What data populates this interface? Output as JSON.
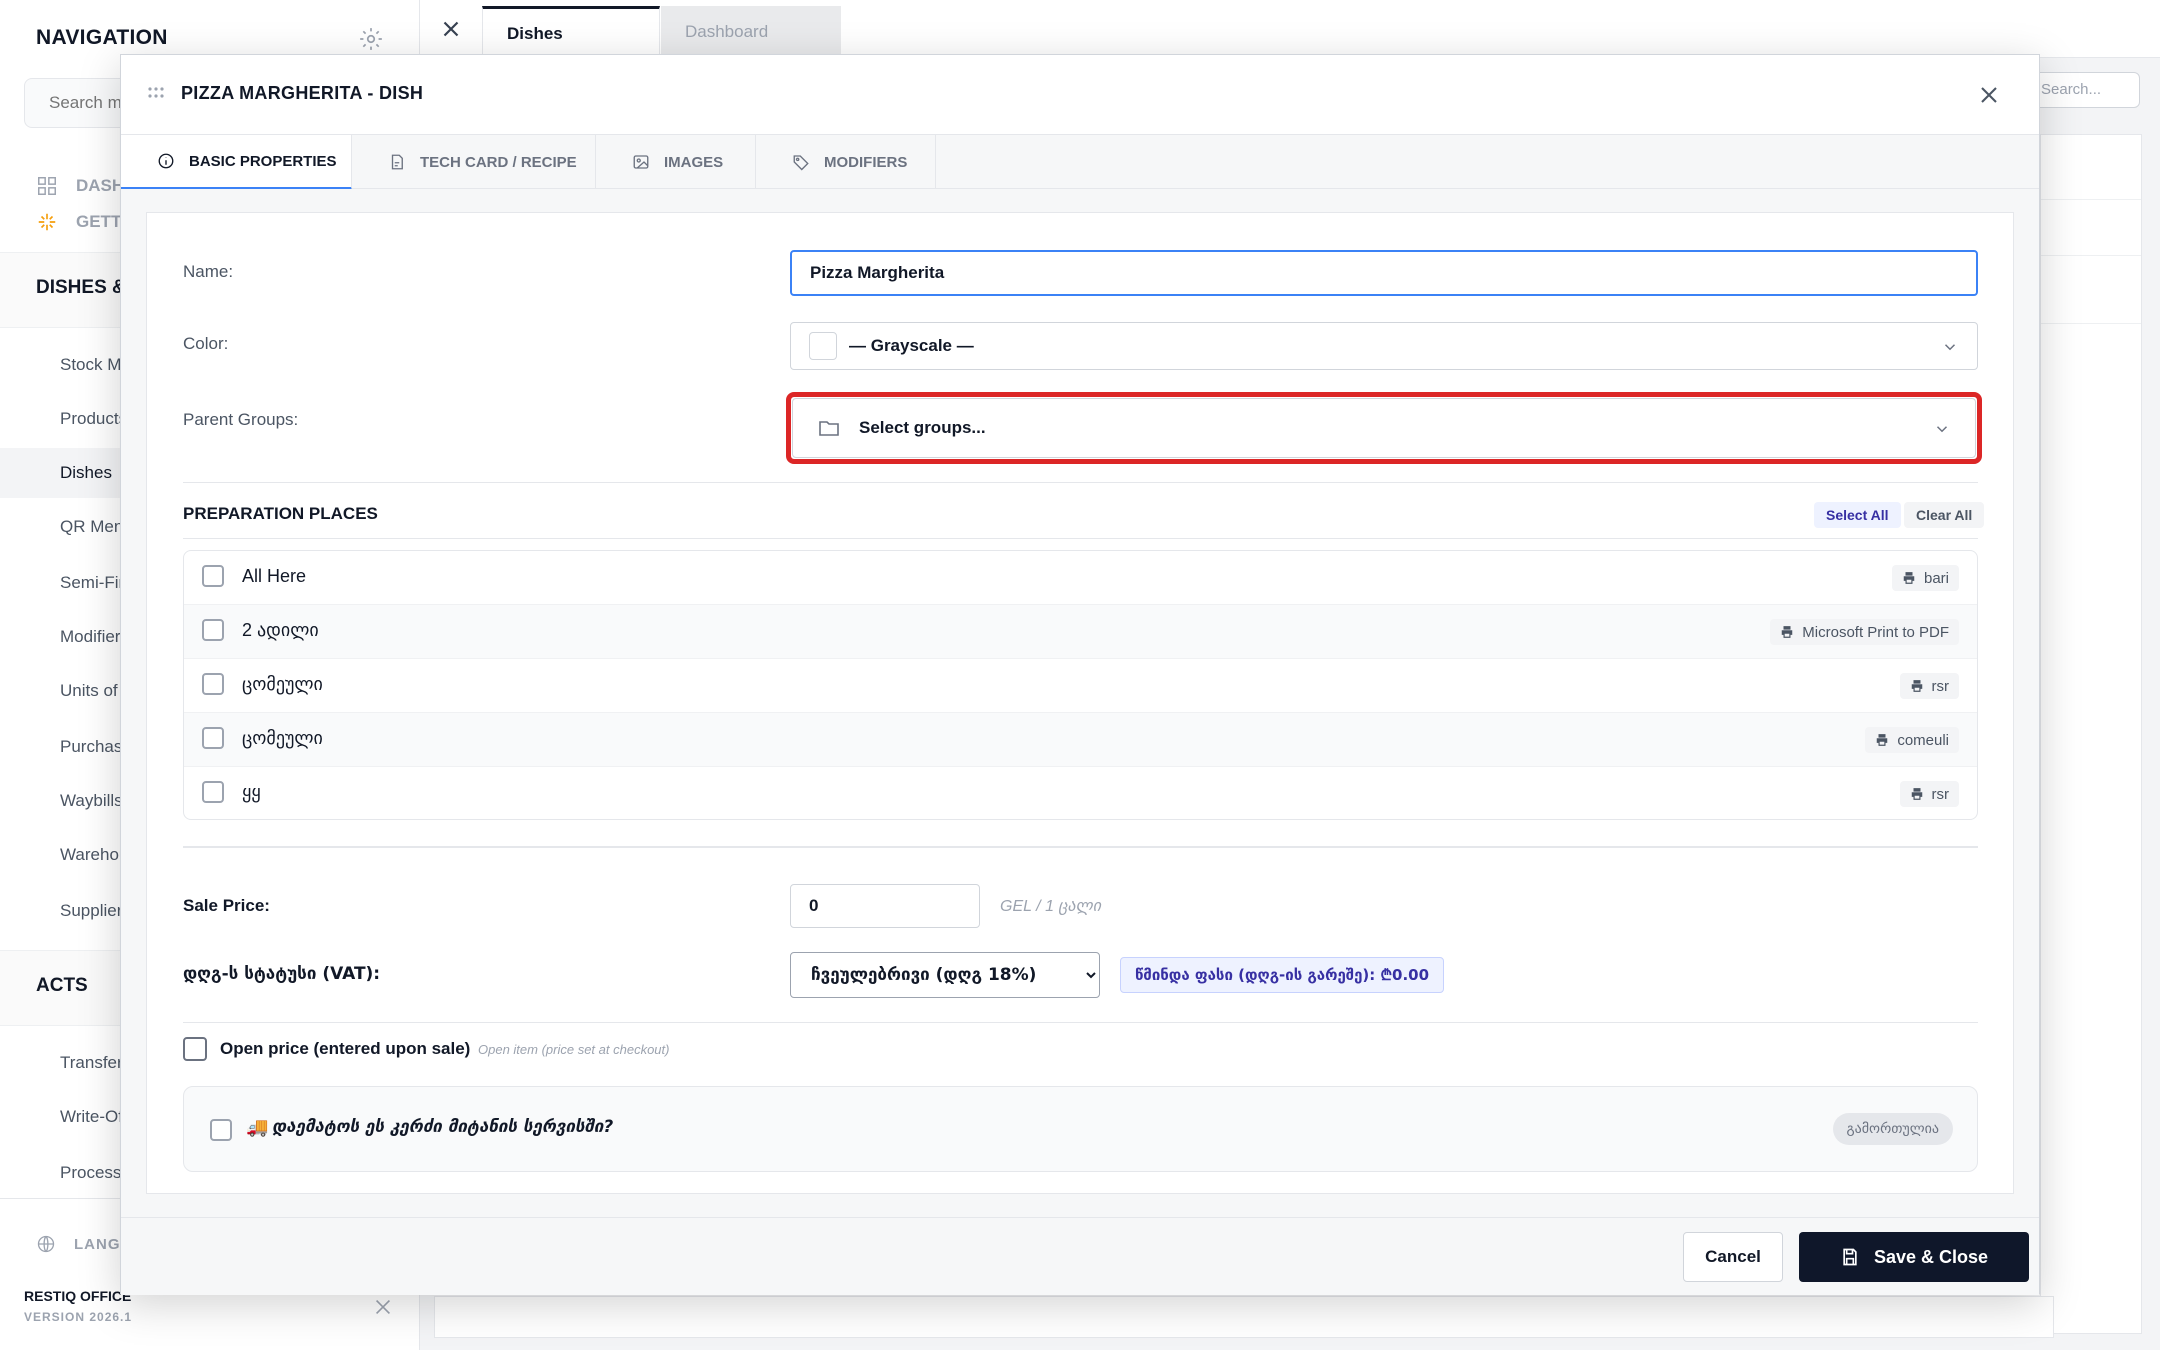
{
  "sidebar": {
    "title": "NAVIGATION",
    "search_placeholder": "Search menu...",
    "top_items": [
      {
        "label": "DASHBOARD",
        "icon": "grid-icon"
      },
      {
        "label": "GETTING STARTED",
        "icon": "sparkle-icon"
      }
    ],
    "sections": [
      {
        "title": "DISHES & PRODUCTS",
        "items": [
          "Stock Management",
          "Products",
          "Dishes",
          "QR Menu",
          "Semi-Finished",
          "Modifiers",
          "Units of Measure",
          "Purchases",
          "Waybills",
          "Warehouses",
          "Suppliers"
        ]
      },
      {
        "title": "ACTS",
        "items": [
          "Transfers",
          "Write-Offs",
          "Processing"
        ]
      }
    ],
    "language": "LANGUAGE",
    "brand_name": "RESTIQ OFFICE",
    "version": "VERSION 2026.1"
  },
  "app_tabs": [
    {
      "label": "Dishes",
      "active": true
    },
    {
      "label": "Dashboard",
      "active": false
    }
  ],
  "background": {
    "search_placeholder": "Search..."
  },
  "modal": {
    "title": "PIZZA MARGHERITA - DISH",
    "tabs": [
      {
        "label": "BASIC PROPERTIES",
        "icon": "info-icon",
        "active": true
      },
      {
        "label": "TECH CARD / RECIPE",
        "icon": "document-icon",
        "active": false
      },
      {
        "label": "IMAGES",
        "icon": "image-icon",
        "active": false
      },
      {
        "label": "MODIFIERS",
        "icon": "tag-icon",
        "active": false
      }
    ],
    "form": {
      "name_label": "Name:",
      "name_value": "Pizza Margherita",
      "color_label": "Color:",
      "color_value": "— Grayscale —",
      "groups_label": "Parent Groups:",
      "groups_placeholder": "Select groups..."
    },
    "preparation": {
      "title": "PREPARATION PLACES",
      "select_all": "Select All",
      "clear_all": "Clear All",
      "places": [
        {
          "name": "All Here",
          "printer": "bari"
        },
        {
          "name": "2 ადილი",
          "printer": "Microsoft Print to PDF"
        },
        {
          "name": "ცომეული",
          "printer": "rsr"
        },
        {
          "name": "ცომეული",
          "printer": "comeuli"
        },
        {
          "name": "ყყ",
          "printer": "rsr"
        }
      ]
    },
    "pricing": {
      "sale_price_label": "Sale Price:",
      "sale_price_value": "0",
      "unit_hint": "GEL / 1 ცალი",
      "vat_label": "დღგ-ს სტატუსი (VAT):",
      "vat_value": "ჩვეულებრივი (დღგ 18%)",
      "net_price": "წმინდა ფასი (დღგ-ის გარეშე): ₾0.00"
    },
    "open_price": {
      "label": "Open price (entered upon sale)",
      "hint": "Open item (price set at checkout)"
    },
    "delivery": {
      "label": "დაემატოს ეს კერძი მიტანის სერვისში?",
      "status": "გამორთულია"
    },
    "footer": {
      "cancel": "Cancel",
      "save": "Save & Close"
    }
  },
  "colors": {
    "accent": "#3b82f6",
    "highlight": "#dc2626",
    "primary_button": "#0f172a"
  }
}
